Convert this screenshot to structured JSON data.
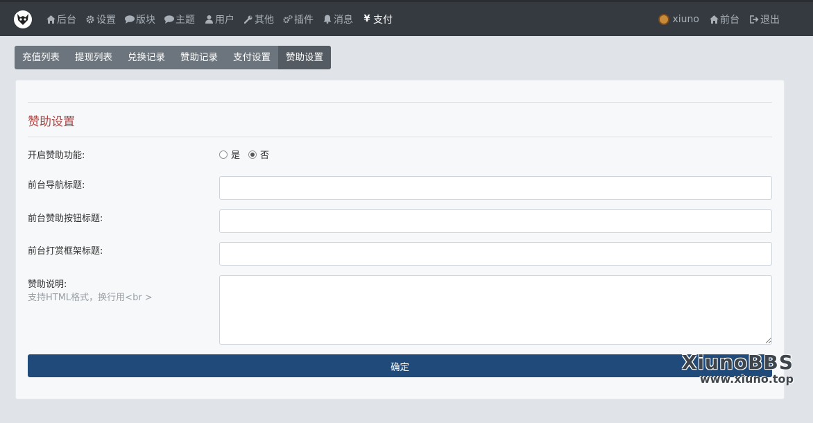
{
  "nav": {
    "logo_icon": "xiuno-logo-icon",
    "items": [
      {
        "label": "后台",
        "icon": "home-icon"
      },
      {
        "label": "设置",
        "icon": "gear-icon"
      },
      {
        "label": "版块",
        "icon": "comment-icon"
      },
      {
        "label": "主题",
        "icon": "comment-icon"
      },
      {
        "label": "用户",
        "icon": "user-icon"
      },
      {
        "label": "其他",
        "icon": "wrench-icon"
      },
      {
        "label": "插件",
        "icon": "cogs-icon"
      },
      {
        "label": "消息",
        "icon": "bell-icon"
      },
      {
        "label": "支付",
        "icon": "yen-icon",
        "active": true
      }
    ],
    "right": {
      "username": "xiuno",
      "front_label": "前台",
      "logout_label": "退出"
    }
  },
  "tabs": [
    {
      "label": "充值列表"
    },
    {
      "label": "提现列表"
    },
    {
      "label": "兑换记录"
    },
    {
      "label": "赞助记录"
    },
    {
      "label": "支付设置"
    },
    {
      "label": "赞助设置",
      "active": true
    }
  ],
  "form": {
    "title": "赞助设置",
    "enable_label": "开启赞助功能:",
    "enable_options": {
      "yes": "是",
      "no": "否",
      "selected": "no"
    },
    "nav_title_label": "前台导航标题:",
    "nav_title_value": "",
    "button_title_label": "前台赞助按钮标题:",
    "button_title_value": "",
    "reward_title_label": "前台打赏框架标题:",
    "reward_title_value": "",
    "desc_label": "赞助说明:",
    "desc_hint": "支持HTML格式，换行用<br >",
    "desc_value": "",
    "submit_label": "确定"
  },
  "watermark": {
    "title": "XiunoBBS",
    "url": "www.xiuno.top"
  },
  "colors": {
    "navbar": "#343a40",
    "tab_bg": "#6c757d",
    "tab_active": "#545b62",
    "section_title": "#b0413e",
    "submit": "#1f4a7a"
  }
}
